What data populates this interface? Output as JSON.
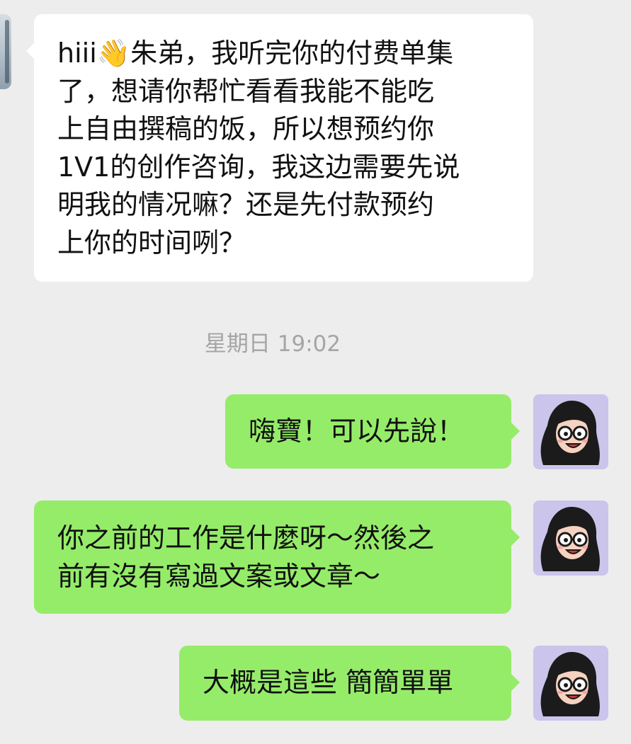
{
  "conversation": {
    "messages": [
      {
        "direction": "incoming",
        "lines": [
          "hiii",
          "朱弟，我听完你的付费单集",
          "了，想请你帮忙看看我能不能吃",
          "上自由撰稿的饭，所以想预约你",
          "1V1的创作咨询，我这边需要先说",
          "明我的情况嘛？还是先付款预约",
          "上你的时间咧？"
        ],
        "emoji": "waving-hand"
      },
      {
        "direction": "outgoing",
        "lines": [
          "嗨寶！可以先說！"
        ]
      },
      {
        "direction": "outgoing",
        "lines": [
          "你之前的工作是什麼呀～然後之",
          "前有沒有寫過文案或文章～"
        ]
      },
      {
        "direction": "outgoing",
        "lines": [
          "大概是這些 簡簡單單"
        ]
      }
    ],
    "timestamp": "星期日 19:02"
  },
  "colors": {
    "background": "#ededed",
    "incoming_bubble": "#ffffff",
    "outgoing_bubble": "#95ec69",
    "timestamp_text": "#a5a5a5",
    "avatar_background": "#cbc5ec"
  },
  "icons": {
    "self_avatar": "cartoon-girl-with-glasses-avatar",
    "contact_avatar": "contact-photo-avatar"
  }
}
